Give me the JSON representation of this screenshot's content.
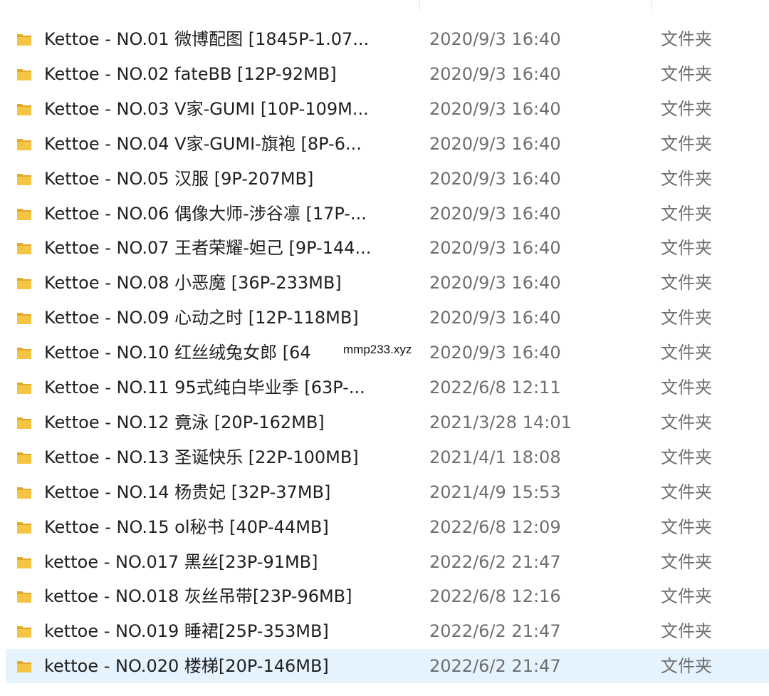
{
  "columns": {
    "name": "",
    "date": "",
    "type": ""
  },
  "items": [
    {
      "name": "Kettoe - NO.01 微博配图 [1845P-1.07...",
      "date": "2020/9/3 16:40",
      "type": "文件夹"
    },
    {
      "name": "Kettoe - NO.02 fateBB [12P-92MB]",
      "date": "2020/9/3 16:40",
      "type": "文件夹"
    },
    {
      "name": "Kettoe - NO.03 V家-GUMI [10P-109M...",
      "date": "2020/9/3 16:40",
      "type": "文件夹"
    },
    {
      "name": "Kettoe - NO.04 V家-GUMI-旗袍 [8P-6...",
      "date": "2020/9/3 16:40",
      "type": "文件夹"
    },
    {
      "name": "Kettoe - NO.05 汉服 [9P-207MB]",
      "date": "2020/9/3 16:40",
      "type": "文件夹"
    },
    {
      "name": "Kettoe - NO.06 偶像大师-涉谷凛 [17P-...",
      "date": "2020/9/3 16:40",
      "type": "文件夹"
    },
    {
      "name": "Kettoe - NO.07 王者荣耀-妲己 [9P-144...",
      "date": "2020/9/3 16:40",
      "type": "文件夹"
    },
    {
      "name": "Kettoe - NO.08 小恶魔 [36P-233MB]",
      "date": "2020/9/3 16:40",
      "type": "文件夹"
    },
    {
      "name": "Kettoe - NO.09 心动之时 [12P-118MB]",
      "date": "2020/9/3 16:40",
      "type": "文件夹"
    },
    {
      "name": "Kettoe - NO.10 红丝绒兔女郎 [64",
      "date": "2020/9/3 16:40",
      "type": "文件夹"
    },
    {
      "name": "Kettoe - NO.11 95式纯白毕业季 [63P-...",
      "date": "2022/6/8 12:11",
      "type": "文件夹"
    },
    {
      "name": "Kettoe - NO.12 竟泳 [20P-162MB]",
      "date": "2021/3/28 14:01",
      "type": "文件夹"
    },
    {
      "name": "Kettoe - NO.13 圣诞快乐 [22P-100MB]",
      "date": "2021/4/1 18:08",
      "type": "文件夹"
    },
    {
      "name": "Kettoe - NO.14 杨贵妃 [32P-37MB]",
      "date": "2021/4/9 15:53",
      "type": "文件夹"
    },
    {
      "name": "Kettoe - NO.15 ol秘书 [40P-44MB]",
      "date": "2022/6/8 12:09",
      "type": "文件夹"
    },
    {
      "name": "kettoe - NO.017 黑丝[23P-91MB]",
      "date": "2022/6/2 21:47",
      "type": "文件夹"
    },
    {
      "name": "kettoe - NO.018 灰丝吊带[23P-96MB]",
      "date": "2022/6/8 12:16",
      "type": "文件夹"
    },
    {
      "name": "kettoe - NO.019 睡裙[25P-353MB]",
      "date": "2022/6/2 21:47",
      "type": "文件夹"
    },
    {
      "name": "kettoe - NO.020 楼梯[20P-146MB]",
      "date": "2022/6/2 21:47",
      "type": "文件夹",
      "selected": true
    }
  ],
  "watermark": "mmp233.xyz",
  "colors": {
    "folder": "#f4c542",
    "folder_shade": "#e0a92a",
    "selected_row": "#e5f3ff"
  }
}
